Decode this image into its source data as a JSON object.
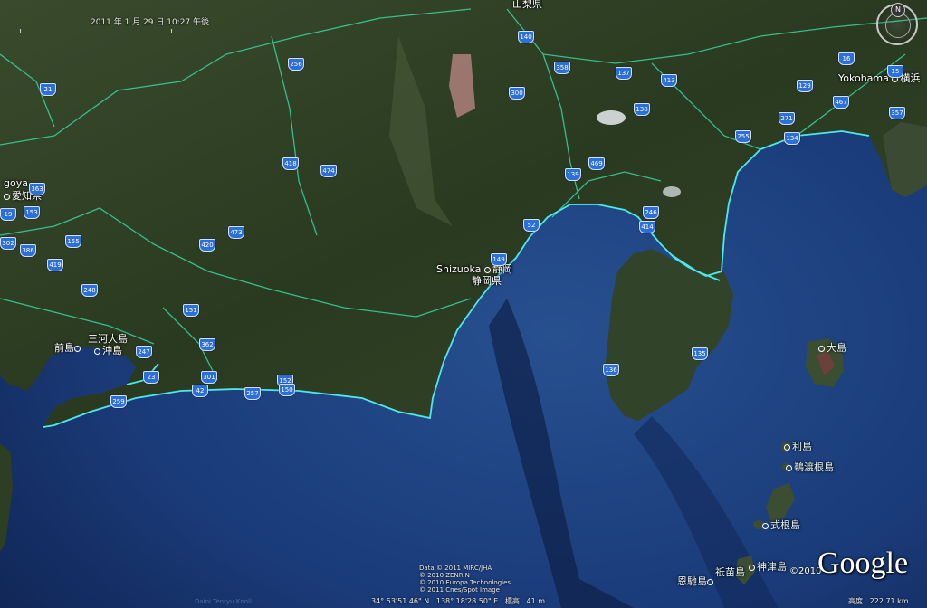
{
  "header": {
    "date_text": "2011 年 1 月 29 日 10:27 午後"
  },
  "compass": {
    "north_label": "N"
  },
  "places": {
    "nagoya": "goya",
    "aichi": "愛知県",
    "yamanashi": "山梨県",
    "yokohama": "Yokohama",
    "yokohama_jp": "横浜",
    "shizuoka": "Shizuoka",
    "shizuoka_jp": "静岡",
    "shizuoka_pref": "静岡県",
    "mikawa": "三河大島",
    "oki": "沖島",
    "mae": "前島"
  },
  "islands": {
    "oshima": "大島",
    "toshima": "利島",
    "udone": "鵜渡根島",
    "shikine": "式根島",
    "kozu": "神津島",
    "onbase": "恩馳島",
    "sonae": "祗苗島"
  },
  "routes": [
    "21",
    "256",
    "140",
    "358",
    "137",
    "413",
    "16",
    "15",
    "129",
    "467",
    "357",
    "300",
    "138",
    "271",
    "255",
    "134",
    "418",
    "474",
    "139",
    "469",
    "363",
    "153",
    "155",
    "19",
    "302",
    "386",
    "419",
    "473",
    "420",
    "52",
    "246",
    "414",
    "149",
    "248",
    "151",
    "362",
    "247",
    "23",
    "301",
    "42",
    "152",
    "150",
    "257",
    "259",
    "136",
    "135"
  ],
  "attribution": {
    "line1": "Data © 2011 MIRC/JHA",
    "line2": "© 2010 ZENRIN",
    "line3": "© 2010 Europa Technologies",
    "line4": "© 2011 Cnes/Spot Image"
  },
  "status": {
    "lat": "34° 53'51.46\" N",
    "lon": "138° 18'28.50\" E",
    "elev_label": "標高",
    "elev_value": "41 m",
    "alt_label": "高度",
    "alt_value": "222.71 km",
    "undersea_name": "Daini Tenryu Knoll"
  },
  "branding": {
    "copyright": "©2010",
    "logo": "Google"
  },
  "colors": {
    "coast": "#4de8ec",
    "road": "#39d3a4",
    "ocean": "#1d3f80",
    "land": "#2c3e22",
    "shield": "#2d6fd8"
  }
}
